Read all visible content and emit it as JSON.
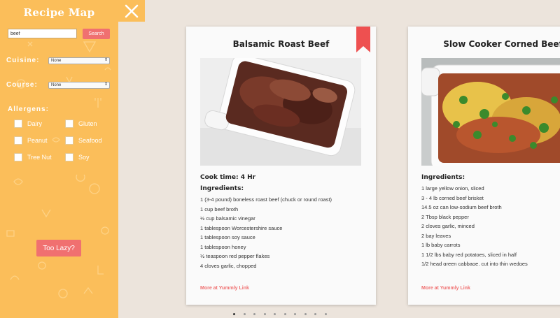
{
  "sidebar": {
    "title": "Recipe Map",
    "search": {
      "value": "beef",
      "button": "Search"
    },
    "cuisine": {
      "label": "Cuisine:",
      "selected": "None"
    },
    "course": {
      "label": "Course:",
      "selected": "None"
    },
    "allergens": {
      "label": "Allergens:",
      "items": [
        "Dairy",
        "Gluten",
        "Peanut",
        "Seafood",
        "Tree Nut",
        "Soy"
      ]
    },
    "lazy_button": "Too Lazy?"
  },
  "close_icon": "close-icon",
  "cards": [
    {
      "title": "Balsamic Roast Beef",
      "cook_time": "Cook time: 4 Hr",
      "ingredients_label": "Ingredients:",
      "ingredients": [
        "1 (3-4 pound) boneless roast beef (chuck or round roast)",
        "1 cup beef broth",
        "½ cup balsamic vinegar",
        "1 tablespoon Worcestershire sauce",
        "1 tablespoon soy sauce",
        "1 tablespoon honey",
        "½ teaspoon red pepper flakes",
        "4 cloves garlic, chopped"
      ],
      "link": "More at Yummly Link",
      "bookmarked": true
    },
    {
      "title": "Slow Cooker Corned Beef",
      "ingredients_label": "Ingredients:",
      "ingredients": [
        "1 large yellow onion, sliced",
        "3 - 4 lb corned beef brisket",
        "14.5 oz can low-sodium beef broth",
        "2 Tbsp black pepper",
        "2 cloves garlic, minced",
        "2 bay leaves",
        "1 lb baby carrots",
        "1 1/2 lbs baby red potatoes, sliced in half",
        "1/2 head green cabbage, cut into thin wedges"
      ],
      "link": "More at Yummly Link"
    }
  ],
  "pagination": {
    "total": 10,
    "active": 1
  },
  "colors": {
    "sidebar": "#fbbe5a",
    "accent": "#f07070",
    "link": "#ef6f6f",
    "background": "#ece4dc"
  }
}
